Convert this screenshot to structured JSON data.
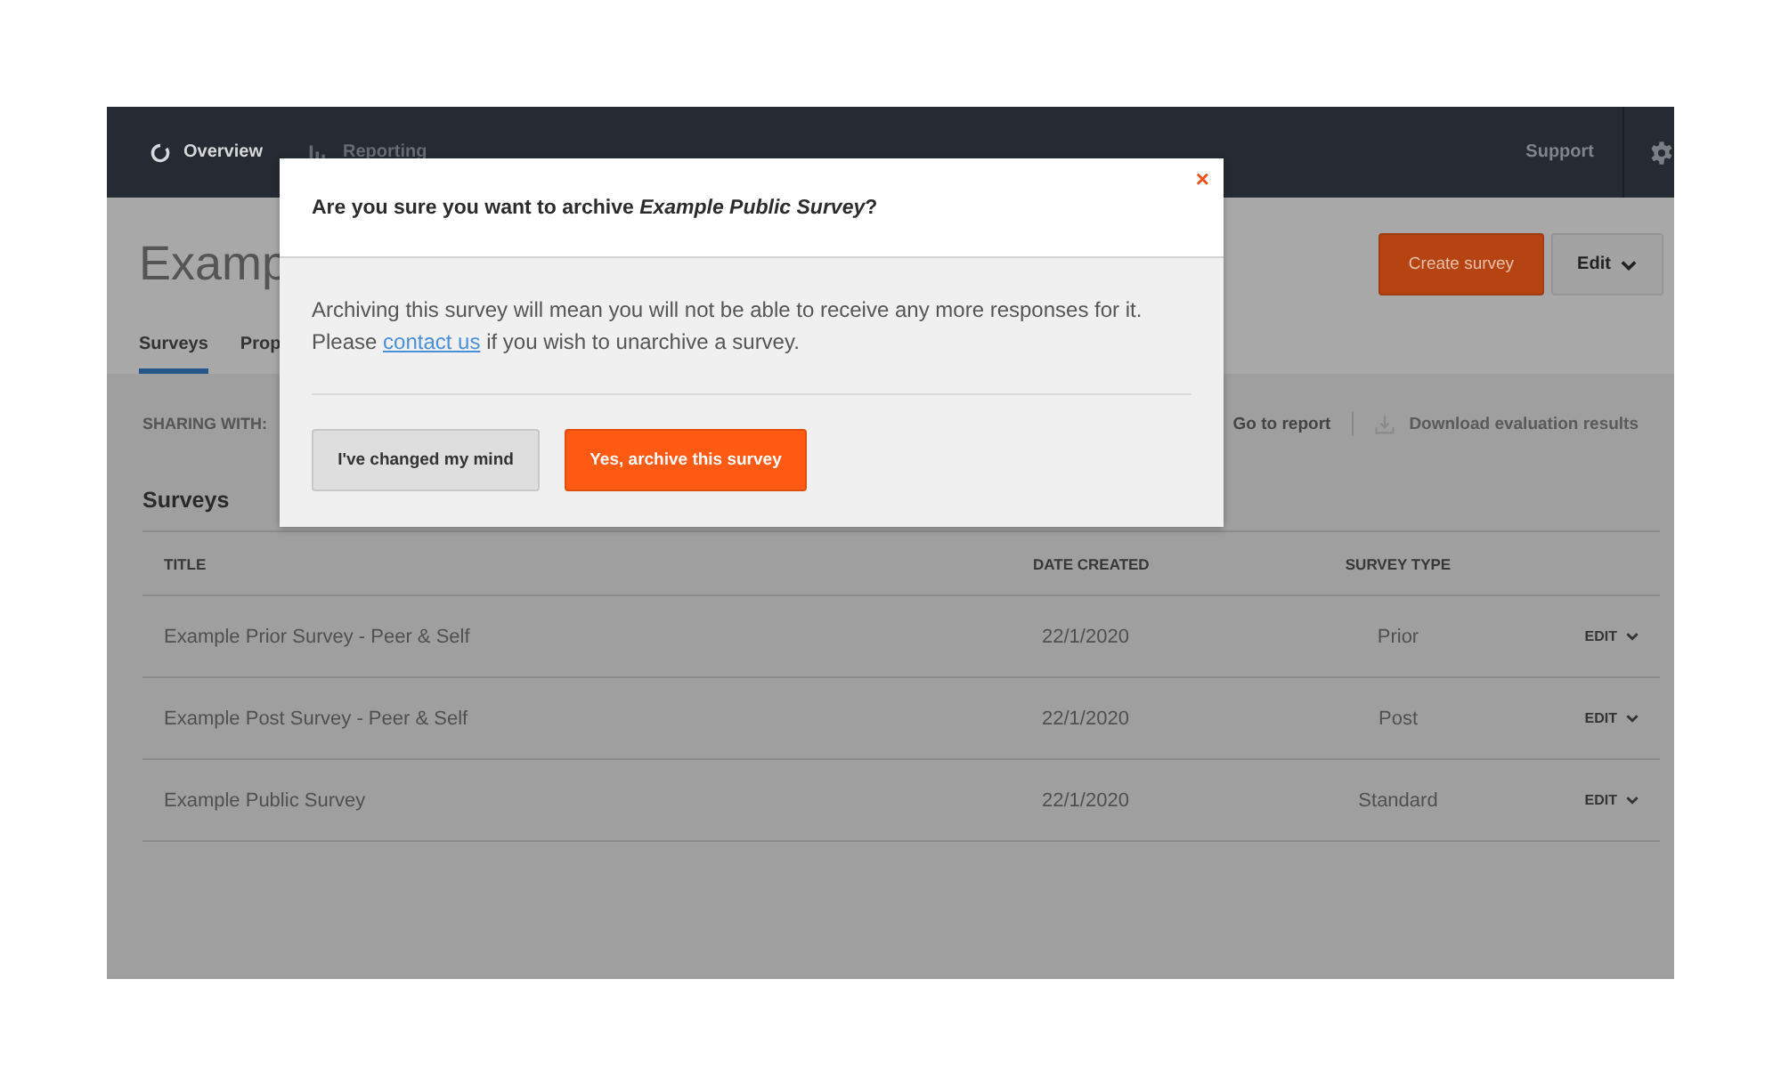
{
  "nav": {
    "items": [
      {
        "label": "Overview",
        "kind": "spinner",
        "selected": true
      },
      {
        "label": "Reporting",
        "kind": "chart",
        "selected": false
      }
    ],
    "support": "Support"
  },
  "header": {
    "title": "Examp",
    "tabs": [
      {
        "label": "Surveys",
        "selected": true
      },
      {
        "label": "Prop",
        "selected": false
      }
    ],
    "create": "Create survey",
    "edit": "Edit"
  },
  "toolbar": {
    "sharing": "SHARING WITH:",
    "report": "Go to report",
    "download": "Download evaluation results"
  },
  "surveys": {
    "heading": "Surveys",
    "columns": [
      "TITLE",
      "DATE CREATED",
      "SURVEY TYPE"
    ],
    "rows": [
      {
        "title": "Example Prior Survey - Peer & Self",
        "date": "22/1/2020",
        "type": "Prior",
        "action": "EDIT"
      },
      {
        "title": "Example Post Survey - Peer & Self",
        "date": "22/1/2020",
        "type": "Post",
        "action": "EDIT"
      },
      {
        "title": "Example Public Survey",
        "date": "22/1/2020",
        "type": "Standard",
        "action": "EDIT"
      }
    ]
  },
  "modal": {
    "title": "Are you sure you want to archive *Example Public Survey*?",
    "close": "×",
    "body_before": "Archiving this survey will mean you will not be able to receive any more responses for it. Please ",
    "link": "contact us",
    "body_after": " if you wish to unarchive a survey.",
    "cancel": "I've changed my mind",
    "confirm": "Yes, archive this survey"
  }
}
